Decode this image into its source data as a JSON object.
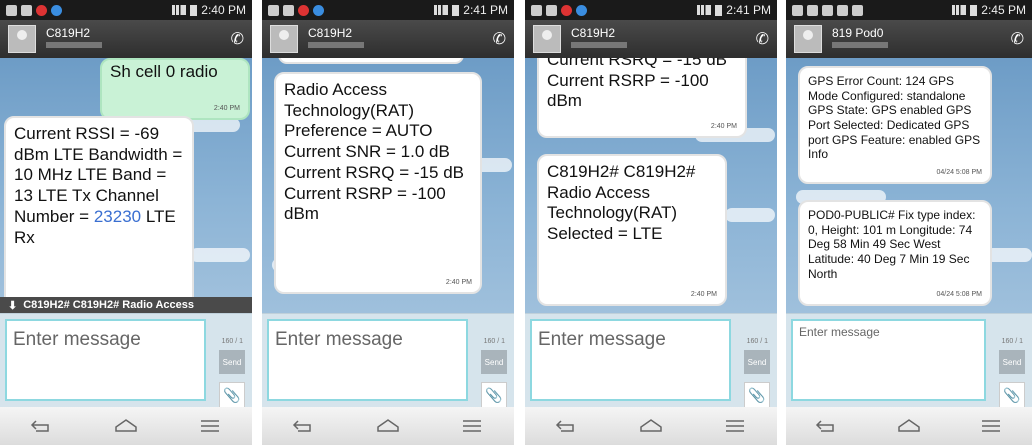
{
  "screens": [
    {
      "status_time": "2:40 PM",
      "contact": "C819H2",
      "messages": [
        {
          "text": "Sh cell 0 radio",
          "time": "2:40 PM",
          "type": "sent"
        },
        {
          "text_before": "Current RSSI = -69 dBm LTE Bandwidth = 10 MHz LTE Band = 13 LTE Tx Channel Number = ",
          "link": "23230",
          "text_after": " LTE Rx",
          "type": "received"
        }
      ],
      "preview": "C819H2# C819H2# Radio Access",
      "compose_placeholder": "Enter message",
      "counter": "160 / 1",
      "send_label": "Send"
    },
    {
      "status_time": "2:41 PM",
      "contact": "C819H2",
      "messages": [
        {
          "text": "Radio Access Technology(RAT) Preference = AUTO Current SNR = 1.0  dB Current RSRQ = -15  dB Current RSRP = -100  dBm",
          "time": "2:40 PM",
          "type": "received"
        }
      ],
      "compose_placeholder": "Enter message",
      "counter": "160 / 1",
      "send_label": "Send"
    },
    {
      "status_time": "2:41 PM",
      "contact": "C819H2",
      "messages": [
        {
          "text": "Current RSRQ = -15  dB Current RSRP = -100  dBm",
          "time": "2:40 PM",
          "type": "received"
        },
        {
          "text": "C819H2# C819H2# Radio Access Technology(RAT) Selected = LTE",
          "time": "2:40 PM",
          "type": "received"
        }
      ],
      "compose_placeholder": "Enter message",
      "counter": "160 / 1",
      "send_label": "Send"
    },
    {
      "status_time": "2:45 PM",
      "contact": "819 Pod0",
      "messages": [
        {
          "text": "GPS Error Count: 124 GPS Mode Configured: standalone GPS State: GPS enabled GPS Port Selected: Dedicated GPS port GPS Feature: enabled GPS Info",
          "time": "04/24 5:08 PM",
          "type": "received"
        },
        {
          "text": "POD0-PUBLIC# Fix type index: 0, Height: 101 m Longitude: 74 Deg 58 Min 49 Sec West Latitude: 40 Deg 7 Min 19 Sec North",
          "time": "04/24 5:08 PM",
          "type": "received"
        }
      ],
      "compose_placeholder": "Enter message",
      "counter": "160 / 1",
      "send_label": "Send"
    }
  ]
}
